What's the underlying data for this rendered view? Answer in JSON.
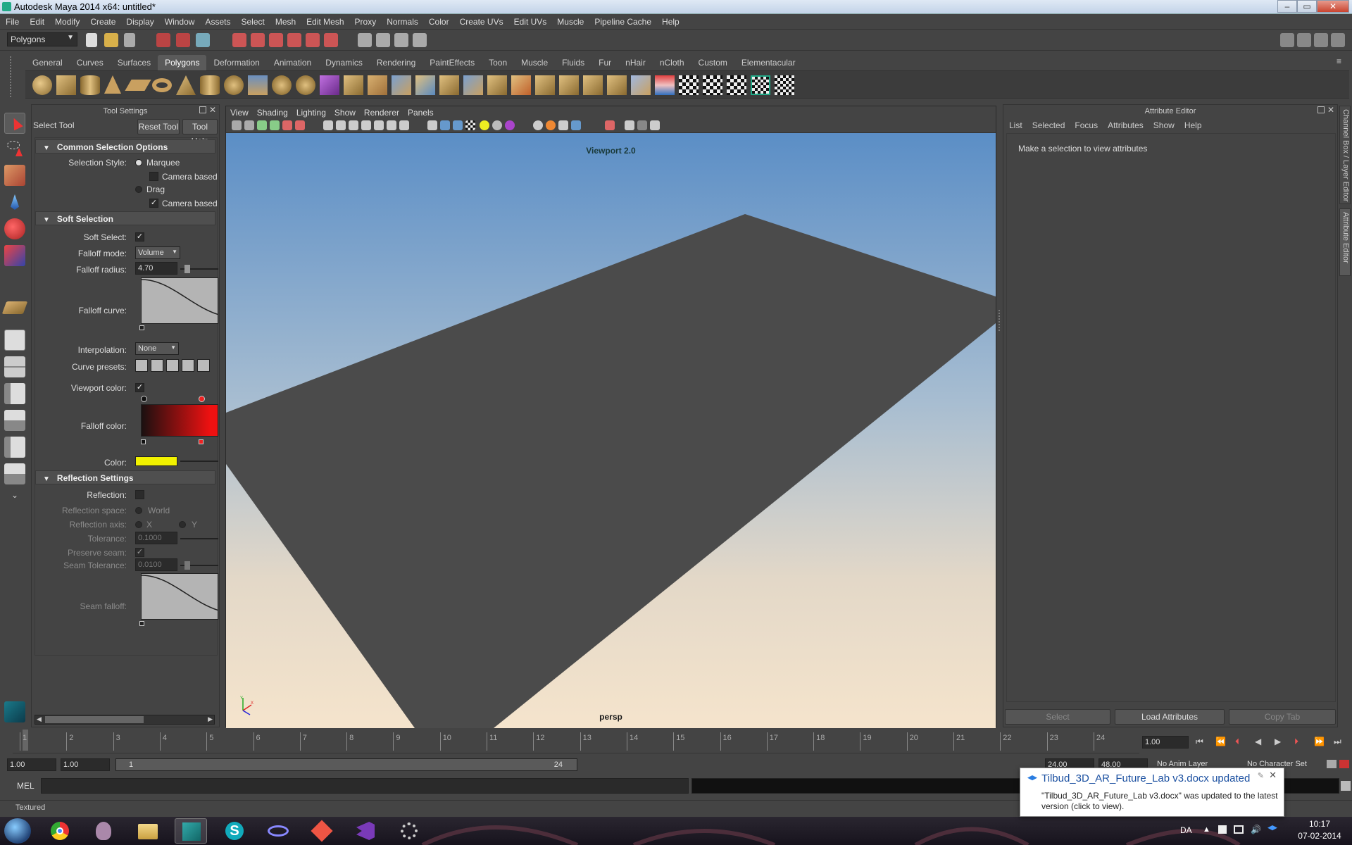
{
  "window": {
    "title": "Autodesk Maya 2014 x64: untitled*"
  },
  "menubar": [
    "File",
    "Edit",
    "Modify",
    "Create",
    "Display",
    "Window",
    "Assets",
    "Select",
    "Mesh",
    "Edit Mesh",
    "Proxy",
    "Normals",
    "Color",
    "Create UVs",
    "Edit UVs",
    "Muscle",
    "Pipeline Cache",
    "Help"
  ],
  "statusline": {
    "mode": "Polygons"
  },
  "shelf_tabs": [
    "General",
    "Curves",
    "Surfaces",
    "Polygons",
    "Deformation",
    "Animation",
    "Dynamics",
    "Rendering",
    "PaintEffects",
    "Toon",
    "Muscle",
    "Fluids",
    "Fur",
    "nHair",
    "nCloth",
    "Custom",
    "Elementacular"
  ],
  "shelf_active": "Polygons",
  "tool_settings": {
    "title": "Tool Settings",
    "tool_name": "Select Tool",
    "reset_button": "Reset Tool",
    "help_button": "Tool Help",
    "common": {
      "header": "Common Selection Options",
      "style_label": "Selection Style:",
      "marquee": "Marquee",
      "camera_based_sel": "Camera based se",
      "drag": "Drag",
      "camera_based_paint": "Camera based pa"
    },
    "soft": {
      "header": "Soft Selection",
      "soft_select_label": "Soft Select:",
      "falloff_mode_label": "Falloff mode:",
      "falloff_mode_value": "Volume",
      "falloff_radius_label": "Falloff radius:",
      "falloff_radius_value": "4.70",
      "falloff_curve_label": "Falloff curve:",
      "interpolation_label": "Interpolation:",
      "interpolation_value": "None",
      "curve_presets_label": "Curve presets:",
      "viewport_color_label": "Viewport color:",
      "falloff_color_label": "Falloff color:",
      "color_label": "Color:",
      "color_value": "#f2f200"
    },
    "reflection": {
      "header": "Reflection Settings",
      "reflection_label": "Reflection:",
      "space_label": "Reflection space:",
      "space_value": "World",
      "axis_label": "Reflection axis:",
      "axis_x": "X",
      "axis_y": "Y",
      "tolerance_label": "Tolerance:",
      "tolerance_value": "0.1000",
      "preserve_label": "Preserve seam:",
      "seam_tol_label": "Seam Tolerance:",
      "seam_tol_value": "0.0100",
      "seam_falloff_label": "Seam falloff:"
    }
  },
  "viewport": {
    "menus": [
      "View",
      "Shading",
      "Lighting",
      "Show",
      "Renderer",
      "Panels"
    ],
    "renderer_label": "Viewport 2.0",
    "camera_label": "persp"
  },
  "attribute_editor": {
    "title": "Attribute Editor",
    "menus": [
      "List",
      "Selected",
      "Focus",
      "Attributes",
      "Show",
      "Help"
    ],
    "message": "Make a selection to view attributes",
    "buttons": {
      "select": "Select",
      "load": "Load Attributes",
      "copy": "Copy Tab"
    },
    "side_tabs": {
      "channel": "Channel Box / Layer Editor",
      "attr": "Attribute Editor"
    }
  },
  "timeline": {
    "ticks": [
      "1",
      "2",
      "3",
      "4",
      "5",
      "6",
      "7",
      "8",
      "9",
      "10",
      "11",
      "12",
      "13",
      "14",
      "15",
      "16",
      "17",
      "18",
      "19",
      "20",
      "21",
      "22",
      "23",
      "24"
    ],
    "current_frame": "1.00"
  },
  "range": {
    "start": "1.00",
    "playback_start": "1.00",
    "slider_start": "1",
    "slider_end": "24",
    "playback_end": "24.00",
    "end": "48.00",
    "anim_layer": "No Anim Layer",
    "char_set": "No Character Set"
  },
  "cmdline": {
    "label": "MEL"
  },
  "helpline": {
    "text": "Textured"
  },
  "toast": {
    "title": "Tilbud_3D_AR_Future_Lab v3.docx updated",
    "body": "\"Tilbud_3D_AR_Future_Lab v3.docx\" was updated to the latest version (click to view)."
  },
  "tray": {
    "lang": "DA",
    "time": "10:17",
    "date": "07-02-2014"
  }
}
